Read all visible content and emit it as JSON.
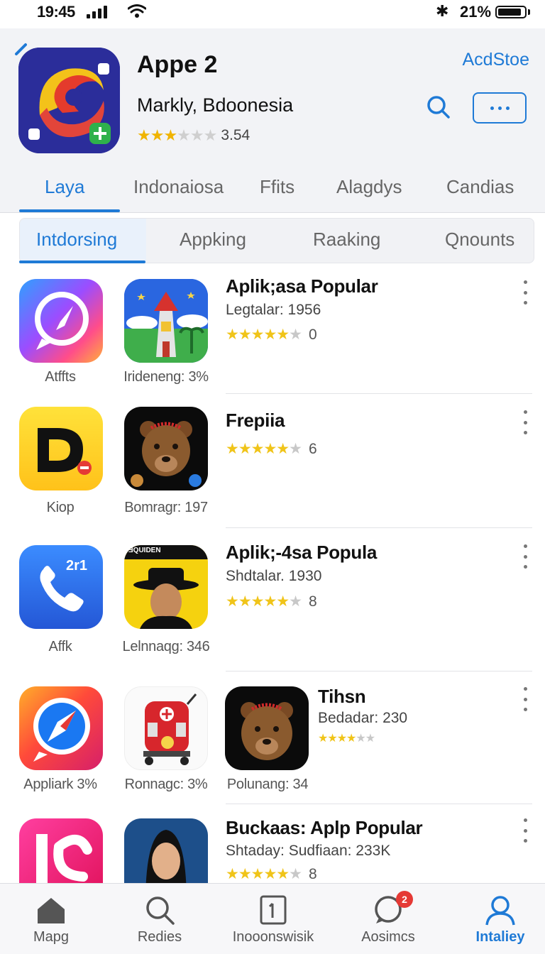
{
  "status_bar": {
    "time": "19:45",
    "battery": "21%"
  },
  "header": {
    "title": "Appe 2",
    "developer": "Mаrkly, Bdoonesia",
    "rating": "3.54",
    "store_link": "AcdStoe"
  },
  "tabs": [
    "Laya",
    "Indonaiosa",
    "Ffits",
    "Alagdys",
    "Candias"
  ],
  "segments": [
    "Intdorsing",
    "Appking",
    "Raaking",
    "Qnounts"
  ],
  "rows": [
    {
      "icons": [
        {
          "name": "chat-compass-app-icon",
          "caption": "Atffts"
        },
        {
          "name": "castle-landscape-app-icon",
          "caption": "Irideneng: 3%"
        }
      ],
      "title": "Aplik;asa Popular",
      "subtitle": "Legtalar: 1956",
      "rating": "0"
    },
    {
      "icons": [
        {
          "name": "letter-d-app-icon",
          "caption": "Kiop"
        },
        {
          "name": "bear-app-icon",
          "caption": "Bomragr: 197"
        }
      ],
      "title": "Frepiia",
      "subtitle": "",
      "rating": "6"
    },
    {
      "icons": [
        {
          "name": "phone-app-icon",
          "caption": "Affk",
          "label": "2r1"
        },
        {
          "name": "portrait-hat-app-icon",
          "caption": "Lelnnaqg: 346",
          "label": "ƎQUIDEN"
        }
      ],
      "title": "Aplik;-4sa Popula",
      "subtitle": "Shdtalar. 1930",
      "rating": "8"
    },
    {
      "icons": [
        {
          "name": "compass-app-icon",
          "caption": "Appliark 3%"
        },
        {
          "name": "robot-app-icon",
          "caption": "Ronnagc: 3%"
        },
        {
          "name": "bear-app-icon",
          "caption": "Polunang: 34"
        }
      ],
      "title": "Tihsn",
      "subtitle": "Bedadar: 230",
      "rating": ""
    },
    {
      "icons": [
        {
          "name": "letters-app-icon",
          "caption": ""
        },
        {
          "name": "woman-portrait-app-icon",
          "caption": ""
        }
      ],
      "title": "Buckaas: Aplp Popular",
      "subtitle": "Shtaday: Sudfiaan: 233K",
      "rating": "8"
    }
  ],
  "bottom_nav": [
    {
      "icon": "home-icon",
      "label": "Mapg"
    },
    {
      "icon": "search-icon",
      "label": "Redies"
    },
    {
      "icon": "bookmark-icon",
      "label": "Inooonswisik"
    },
    {
      "icon": "chat-bubble-icon",
      "label": "Aosimcs",
      "badge": "2"
    },
    {
      "icon": "profile-icon",
      "label": "Intaliey"
    }
  ],
  "colors": {
    "accent": "#1f7ad6",
    "star": "#f0c419",
    "badge": "#e53935"
  }
}
